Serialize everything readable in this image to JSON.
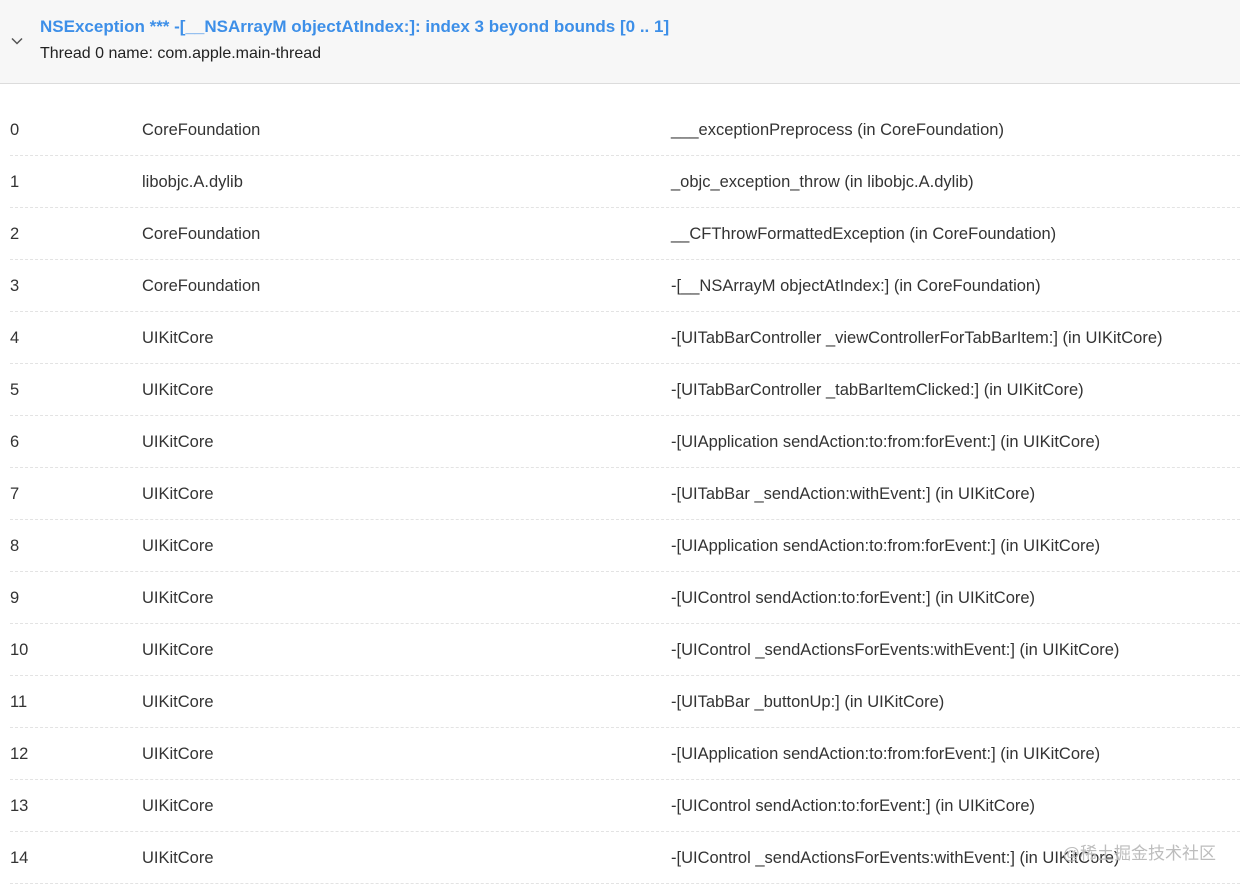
{
  "header": {
    "title": "NSException *** -[__NSArrayM objectAtIndex:]: index 3 beyond bounds [0 .. 1]",
    "subtitle": "Thread 0 name: com.apple.main-thread",
    "toggle_icon": "chevron-down-icon",
    "title_color": "#3d8fe8"
  },
  "frames": [
    {
      "index": "0",
      "library": "CoreFoundation",
      "symbol": "___exceptionPreprocess (in CoreFoundation)"
    },
    {
      "index": "1",
      "library": "libobjc.A.dylib",
      "symbol": "_objc_exception_throw (in libobjc.A.dylib)"
    },
    {
      "index": "2",
      "library": "CoreFoundation",
      "symbol": "__CFThrowFormattedException (in CoreFoundation)"
    },
    {
      "index": "3",
      "library": "CoreFoundation",
      "symbol": "-[__NSArrayM objectAtIndex:] (in CoreFoundation)"
    },
    {
      "index": "4",
      "library": "UIKitCore",
      "symbol": "-[UITabBarController _viewControllerForTabBarItem:] (in UIKitCore)"
    },
    {
      "index": "5",
      "library": "UIKitCore",
      "symbol": "-[UITabBarController _tabBarItemClicked:] (in UIKitCore)"
    },
    {
      "index": "6",
      "library": "UIKitCore",
      "symbol": "-[UIApplication sendAction:to:from:forEvent:] (in UIKitCore)"
    },
    {
      "index": "7",
      "library": "UIKitCore",
      "symbol": "-[UITabBar _sendAction:withEvent:] (in UIKitCore)"
    },
    {
      "index": "8",
      "library": "UIKitCore",
      "symbol": "-[UIApplication sendAction:to:from:forEvent:] (in UIKitCore)"
    },
    {
      "index": "9",
      "library": "UIKitCore",
      "symbol": "-[UIControl sendAction:to:forEvent:] (in UIKitCore)"
    },
    {
      "index": "10",
      "library": "UIKitCore",
      "symbol": "-[UIControl _sendActionsForEvents:withEvent:] (in UIKitCore)"
    },
    {
      "index": "11",
      "library": "UIKitCore",
      "symbol": "-[UITabBar _buttonUp:] (in UIKitCore)"
    },
    {
      "index": "12",
      "library": "UIKitCore",
      "symbol": "-[UIApplication sendAction:to:from:forEvent:] (in UIKitCore)"
    },
    {
      "index": "13",
      "library": "UIKitCore",
      "symbol": "-[UIControl sendAction:to:forEvent:] (in UIKitCore)"
    },
    {
      "index": "14",
      "library": "UIKitCore",
      "symbol": "-[UIControl _sendActionsForEvents:withEvent:] (in UIKitCore)"
    }
  ],
  "watermark": "@稀土掘金技术社区"
}
